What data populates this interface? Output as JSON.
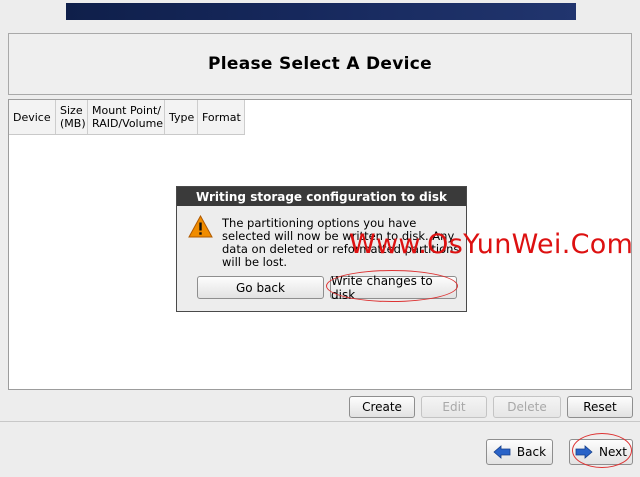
{
  "header": {
    "title": "Please Select A Device"
  },
  "table": {
    "columns": [
      "Device",
      "Size\n(MB)",
      "Mount Point/\nRAID/Volume",
      "Type",
      "Format"
    ]
  },
  "actions": {
    "create": "Create",
    "edit": "Edit",
    "delete": "Delete",
    "reset": "Reset"
  },
  "nav": {
    "back": "Back",
    "next": "Next"
  },
  "dialog": {
    "title": "Writing storage configuration to disk",
    "message": "The partitioning options you have selected will now be written to disk.  Any data on deleted or reformatted partitions will be lost.",
    "go_back": "Go back",
    "write": "Write changes to disk"
  },
  "watermark": "Www.OsYunWei.Com",
  "colors": {
    "banner": "#16285c",
    "dialog_title": "#3a3a3a",
    "watermark": "#dd1111",
    "arrow": "#2a63c8",
    "warning": "#f08c00"
  },
  "icons": {
    "warning": "warning-icon",
    "back": "arrow-left-icon",
    "next": "arrow-right-icon"
  }
}
